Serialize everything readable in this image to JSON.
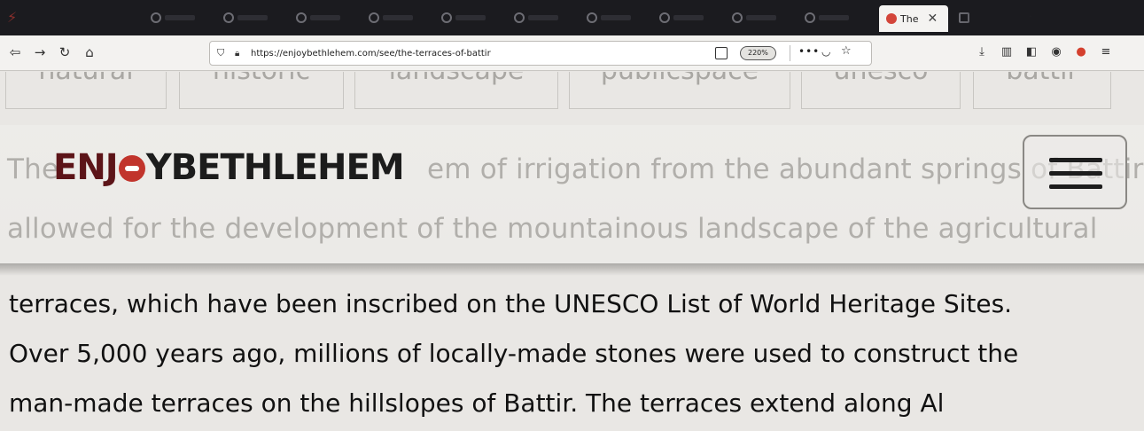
{
  "browser": {
    "active_tab": {
      "title": "The",
      "close_glyph": "✕"
    },
    "new_tab_glyph": "+",
    "url": "https://enjoybethlehem.com/see/the-terraces-of-battir",
    "zoom": "220%",
    "more_glyph": "•••"
  },
  "page": {
    "tags": [
      "natural",
      "historic",
      "landscape",
      "publicspace",
      "unesco",
      "battir"
    ],
    "logo": {
      "enjoy": "ENJ",
      "rest": "YBETHLEHEM"
    },
    "faded_lines": [
      "The",
      "em of irrigation from the abundant springs of Battir",
      "allowed for the development of the mountainous landscape of the agricultural"
    ],
    "body_lines": [
      "terraces, which have been inscribed on the UNESCO List of World Heritage Sites.",
      "Over 5,000 years ago, millions of locally-made stones were used to construct the",
      "man-made terraces on the hillslopes of Battir. The terraces extend along Al"
    ]
  },
  "colors": {
    "logo_dark_red": "#5c1418",
    "logo_smile_red": "#c1342c",
    "tab_bar": "#1b1b1f"
  }
}
